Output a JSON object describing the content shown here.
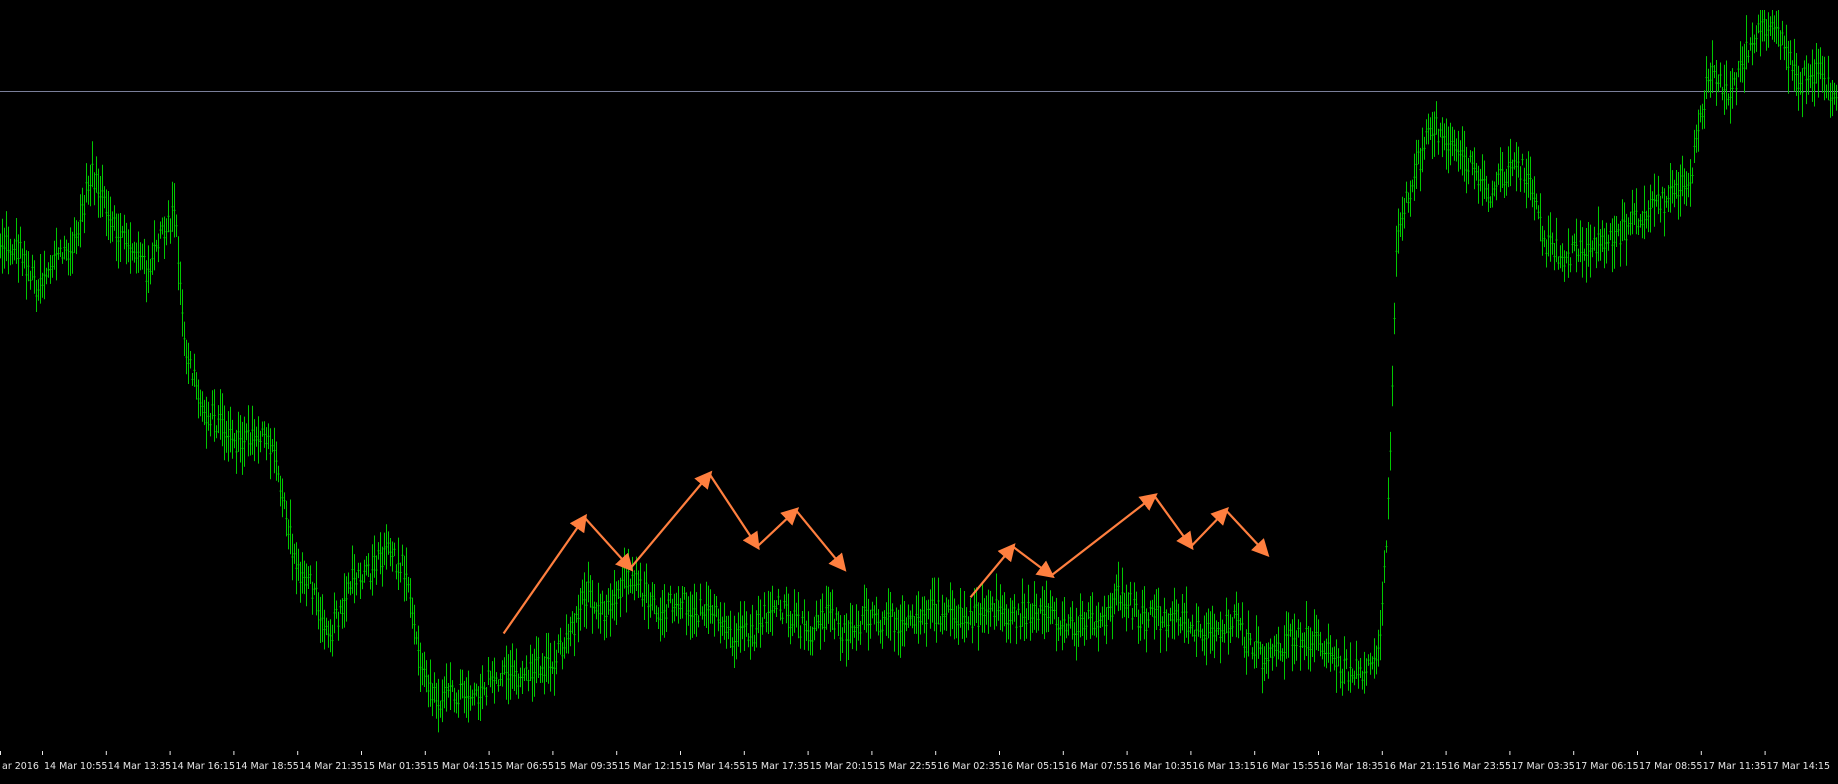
{
  "chart_data": {
    "type": "line",
    "style": "bar-ohlc",
    "background": "#000000",
    "price_color": "#00c800",
    "annotation_color": "#ff7f3f",
    "level_line_color": "#7a7f9a",
    "grid": false,
    "x_ticks": [
      "ar 2016",
      "14 Mar 10:55",
      "14 Mar 13:35",
      "14 Mar 16:15",
      "14 Mar 18:55",
      "14 Mar 21:35",
      "15 Mar 01:35",
      "15 Mar 04:15",
      "15 Mar 06:55",
      "15 Mar 09:35",
      "15 Mar 12:15",
      "15 Mar 14:55",
      "15 Mar 17:35",
      "15 Mar 20:15",
      "15 Mar 22:55",
      "16 Mar 02:35",
      "16 Mar 05:15",
      "16 Mar 07:55",
      "16 Mar 10:35",
      "16 Mar 13:15",
      "16 Mar 15:55",
      "16 Mar 18:35",
      "16 Mar 21:15",
      "16 Mar 23:55",
      "17 Mar 03:35",
      "17 Mar 06:15",
      "17 Mar 08:55",
      "17 Mar 11:35",
      "17 Mar 14:15"
    ],
    "price_path_relative": [
      [
        0,
        0.32
      ],
      [
        0.01,
        0.33
      ],
      [
        0.02,
        0.38
      ],
      [
        0.03,
        0.34
      ],
      [
        0.04,
        0.33
      ],
      [
        0.05,
        0.22
      ],
      [
        0.06,
        0.3
      ],
      [
        0.07,
        0.32
      ],
      [
        0.08,
        0.36
      ],
      [
        0.09,
        0.3
      ],
      [
        0.095,
        0.28
      ],
      [
        0.1,
        0.46
      ],
      [
        0.11,
        0.55
      ],
      [
        0.12,
        0.57
      ],
      [
        0.13,
        0.6
      ],
      [
        0.14,
        0.58
      ],
      [
        0.15,
        0.62
      ],
      [
        0.16,
        0.76
      ],
      [
        0.17,
        0.8
      ],
      [
        0.18,
        0.86
      ],
      [
        0.19,
        0.79
      ],
      [
        0.2,
        0.78
      ],
      [
        0.21,
        0.75
      ],
      [
        0.22,
        0.77
      ],
      [
        0.23,
        0.92
      ],
      [
        0.24,
        0.95
      ],
      [
        0.25,
        0.94
      ],
      [
        0.26,
        0.94
      ],
      [
        0.27,
        0.92
      ],
      [
        0.28,
        0.92
      ],
      [
        0.29,
        0.91
      ],
      [
        0.3,
        0.9
      ],
      [
        0.31,
        0.86
      ],
      [
        0.32,
        0.8
      ],
      [
        0.33,
        0.83
      ],
      [
        0.34,
        0.78
      ],
      [
        0.35,
        0.8
      ],
      [
        0.36,
        0.83
      ],
      [
        0.37,
        0.81
      ],
      [
        0.38,
        0.83
      ],
      [
        0.39,
        0.84
      ],
      [
        0.4,
        0.87
      ],
      [
        0.41,
        0.86
      ],
      [
        0.42,
        0.82
      ],
      [
        0.43,
        0.84
      ],
      [
        0.44,
        0.86
      ],
      [
        0.45,
        0.83
      ],
      [
        0.46,
        0.86
      ],
      [
        0.47,
        0.84
      ],
      [
        0.48,
        0.85
      ],
      [
        0.49,
        0.84
      ],
      [
        0.5,
        0.83
      ],
      [
        0.51,
        0.83
      ],
      [
        0.52,
        0.84
      ],
      [
        0.53,
        0.84
      ],
      [
        0.54,
        0.82
      ],
      [
        0.55,
        0.84
      ],
      [
        0.56,
        0.83
      ],
      [
        0.57,
        0.84
      ],
      [
        0.58,
        0.85
      ],
      [
        0.59,
        0.84
      ],
      [
        0.6,
        0.84
      ],
      [
        0.61,
        0.8
      ],
      [
        0.62,
        0.84
      ],
      [
        0.63,
        0.84
      ],
      [
        0.64,
        0.84
      ],
      [
        0.65,
        0.85
      ],
      [
        0.66,
        0.86
      ],
      [
        0.67,
        0.84
      ],
      [
        0.68,
        0.88
      ],
      [
        0.69,
        0.9
      ],
      [
        0.7,
        0.87
      ],
      [
        0.71,
        0.86
      ],
      [
        0.72,
        0.88
      ],
      [
        0.73,
        0.91
      ],
      [
        0.74,
        0.91
      ],
      [
        0.75,
        0.88
      ],
      [
        0.755,
        0.7
      ],
      [
        0.76,
        0.3
      ],
      [
        0.77,
        0.22
      ],
      [
        0.78,
        0.16
      ],
      [
        0.79,
        0.18
      ],
      [
        0.8,
        0.22
      ],
      [
        0.81,
        0.25
      ],
      [
        0.82,
        0.22
      ],
      [
        0.83,
        0.22
      ],
      [
        0.84,
        0.32
      ],
      [
        0.85,
        0.34
      ],
      [
        0.86,
        0.33
      ],
      [
        0.87,
        0.32
      ],
      [
        0.88,
        0.31
      ],
      [
        0.89,
        0.29
      ],
      [
        0.9,
        0.27
      ],
      [
        0.91,
        0.26
      ],
      [
        0.92,
        0.22
      ],
      [
        0.93,
        0.08
      ],
      [
        0.94,
        0.12
      ],
      [
        0.95,
        0.06
      ],
      [
        0.96,
        0.02
      ],
      [
        0.97,
        0.05
      ],
      [
        0.98,
        0.1
      ],
      [
        0.99,
        0.08
      ],
      [
        1.0,
        0.14
      ]
    ],
    "annotation_paths_relative": [
      [
        [
          0.274,
          0.86
        ],
        [
          0.318,
          0.7
        ],
        [
          0.343,
          0.77
        ],
        [
          0.386,
          0.64
        ],
        [
          0.412,
          0.74
        ],
        [
          0.433,
          0.69
        ],
        [
          0.459,
          0.77
        ]
      ],
      [
        [
          0.528,
          0.81
        ],
        [
          0.551,
          0.74
        ],
        [
          0.572,
          0.78
        ],
        [
          0.628,
          0.67
        ],
        [
          0.648,
          0.74
        ],
        [
          0.667,
          0.69
        ],
        [
          0.689,
          0.75
        ]
      ]
    ],
    "level_line": {
      "y_relative": 0.112
    }
  }
}
